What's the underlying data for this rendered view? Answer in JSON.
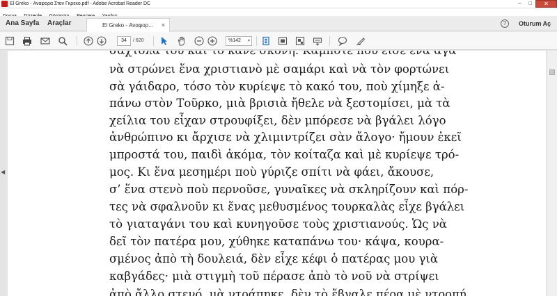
{
  "window": {
    "title": "El Greko - Αναφορα Στον Γκρεκο.pdf - Adobe Acrobat Reader DC",
    "minimize": "–",
    "maximize": "□",
    "close": "✕"
  },
  "menu": [
    "Dosya",
    "Düzenle",
    "Görünüm",
    "Pencere",
    "Yardım"
  ],
  "tabs": {
    "home": "Ana Sayfa",
    "tools": "Araçlar",
    "document": "El Greko - Αναφορ...",
    "close": "×"
  },
  "header": {
    "help": "?",
    "sign_in": "Oturum Aç"
  },
  "toolbar": {
    "page_number": "34",
    "page_total": "/ 620",
    "zoom": "%142",
    "zoom_caret": "▾",
    "icons": [
      "save-icon",
      "print-icon",
      "email-icon",
      "search-icon",
      "previous-page-icon",
      "next-page-icon",
      "select-arrow-icon",
      "hand-icon",
      "zoom-out-icon",
      "zoom-in-icon",
      "fit-page-icon",
      "full-screen-icon",
      "rotate-icon",
      "stamp-icon",
      "comment-icon",
      "sign-pen-icon"
    ]
  },
  "document": {
    "lines": [
      "σαχτόλα του καὶ τὸ κανε σκόνη. Καμποτε που εισε ενα αγα",
      "νὰ στρώνει ἕνα χριστιανὸ μὲ σαμάρι καὶ νὰ τὸν φορτώνει",
      "σὰ γάιδαρο, τόσο τὸν κυρίεψε τὸ κακό του, ποὺ χίμηξε ἀ-",
      "πάνω στὸν Τοῦρκο, μιὰ βρισιὰ ἤθελε νὰ ξεστομίσει, μὰ τὰ",
      "χείλια του εἶχαν στρουφίξει, δὲν μπόρεσε νὰ βγάλει λόγο",
      "ἀνθρώπινο κι ἄρχισε νὰ χλιμιντρίζει σὰν ἄλογο· ἤμουν ἐκεῖ",
      "μπροστά του, παιδὶ ἀκόμα, τὸν κοίταζα καὶ μὲ κυρίεψε τρό-",
      "μος. Κι ἕνα μεσημέρι ποὺ γύριζε σπίτι νὰ φάει, ἄκουσε,",
      "σ’ ἕνα στενὸ ποὺ περνοῦσε, γυναῖκες νὰ σκληρίζουν καὶ πόρ-",
      "τες νὰ σφαλνοῦν κι ἕνας μεθυσμένος τουρκαλὰς εἶχε βγάλει",
      "τὸ γιαταγάνι του καὶ κυνηγοῦσε τοὺς χριστιανούς. Ὡς νὰ",
      "δεῖ τὸν πατέρα μου, χύθηκε καταπάνω του· κάψα, κουρα-",
      "σμένος ἀπὸ τὴ δουλειά, δὲν εἶχε κέφι ὁ πατέρας μου γιὰ",
      "καβγάδες· μιὰ στιγμὴ τοῦ πέρασε ἀπὸ τὸ νοῦ νὰ στρίψει",
      "ἀπὸ ἄλλο στενό, μὰ ντράπηκε, δὲν τὸ ἔβγαλε πέρα μὲ ντροπή"
    ]
  },
  "nav": {
    "left_arrow": "◀",
    "right_arrow": "▶"
  }
}
